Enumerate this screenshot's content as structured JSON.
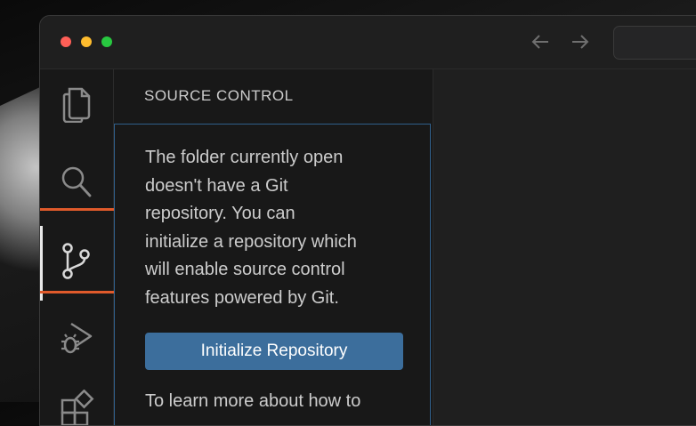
{
  "window": {
    "traffic_lights": [
      "close",
      "minimize",
      "zoom"
    ],
    "nav": {
      "back_icon": "arrow-left-icon",
      "forward_icon": "arrow-right-icon"
    }
  },
  "activity_bar": {
    "items": [
      {
        "name": "explorer",
        "icon": "files-icon"
      },
      {
        "name": "search",
        "icon": "search-icon"
      },
      {
        "name": "source-control",
        "icon": "source-control-icon",
        "active": true
      },
      {
        "name": "run-and-debug",
        "icon": "run-debug-icon"
      },
      {
        "name": "extensions",
        "icon": "extensions-icon"
      }
    ],
    "highlight_color": "#e05a2b"
  },
  "sidebar": {
    "title": "SOURCE CONTROL",
    "message": "The folder currently open\ndoesn't have a Git\nrepository. You can\ninitialize a repository which\nwill enable source control\nfeatures powered by Git.",
    "button_label": "Initialize Repository",
    "message_2": "To learn more about how to"
  },
  "colors": {
    "button_bg": "#3c6e9c",
    "focus_border": "#2f5f8a",
    "text": "#cccccc"
  }
}
